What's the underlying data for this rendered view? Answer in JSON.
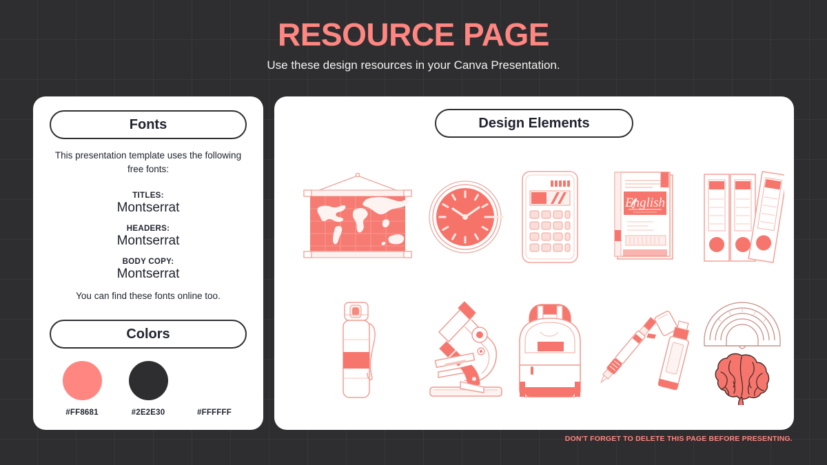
{
  "header": {
    "title": "RESOURCE PAGE",
    "subtitle": "Use these design resources in your Canva Presentation."
  },
  "fonts_card": {
    "section_label": "Fonts",
    "intro": "This presentation template uses the following free fonts:",
    "groups": [
      {
        "role": "TITLES:",
        "font": "Montserrat"
      },
      {
        "role": "HEADERS:",
        "font": "Montserrat"
      },
      {
        "role": "BODY COPY:",
        "font": "Montserrat"
      }
    ],
    "outro": "You can find these fonts online too."
  },
  "colors_card": {
    "section_label": "Colors",
    "swatches": [
      {
        "hex": "#FF8681",
        "name": "salmon-swatch"
      },
      {
        "hex": "#2E2E30",
        "name": "dark-swatch"
      },
      {
        "hex": "#FFFFFF",
        "name": "white-swatch"
      }
    ]
  },
  "elements_card": {
    "section_label": "Design Elements",
    "items": [
      {
        "icon": "world-map-illustration",
        "label": "Hanging world map"
      },
      {
        "icon": "wall-clock-illustration",
        "label": "Wall clock"
      },
      {
        "icon": "calculator-illustration",
        "label": "Calculator"
      },
      {
        "icon": "english-book-illustration",
        "label": "English textbook"
      },
      {
        "icon": "ring-binders-illustration",
        "label": "Ring binders"
      },
      {
        "icon": "water-bottle-illustration",
        "label": "Water bottle"
      },
      {
        "icon": "microscope-illustration",
        "label": "Microscope"
      },
      {
        "icon": "backpack-illustration",
        "label": "Backpack"
      },
      {
        "icon": "pen-highlighter-illustration",
        "label": "Pen and highlighter"
      },
      {
        "icon": "rainbow-brain-illustration",
        "label": "Rainbow and brain"
      }
    ],
    "book_title": "English"
  },
  "footer": {
    "note": "DON'T FORGET TO DELETE THIS PAGE BEFORE PRESENTING."
  },
  "theme": {
    "accent": "#FF8681",
    "background": "#2E2E30",
    "surface": "#FFFFFF",
    "ink": "#20232E"
  }
}
